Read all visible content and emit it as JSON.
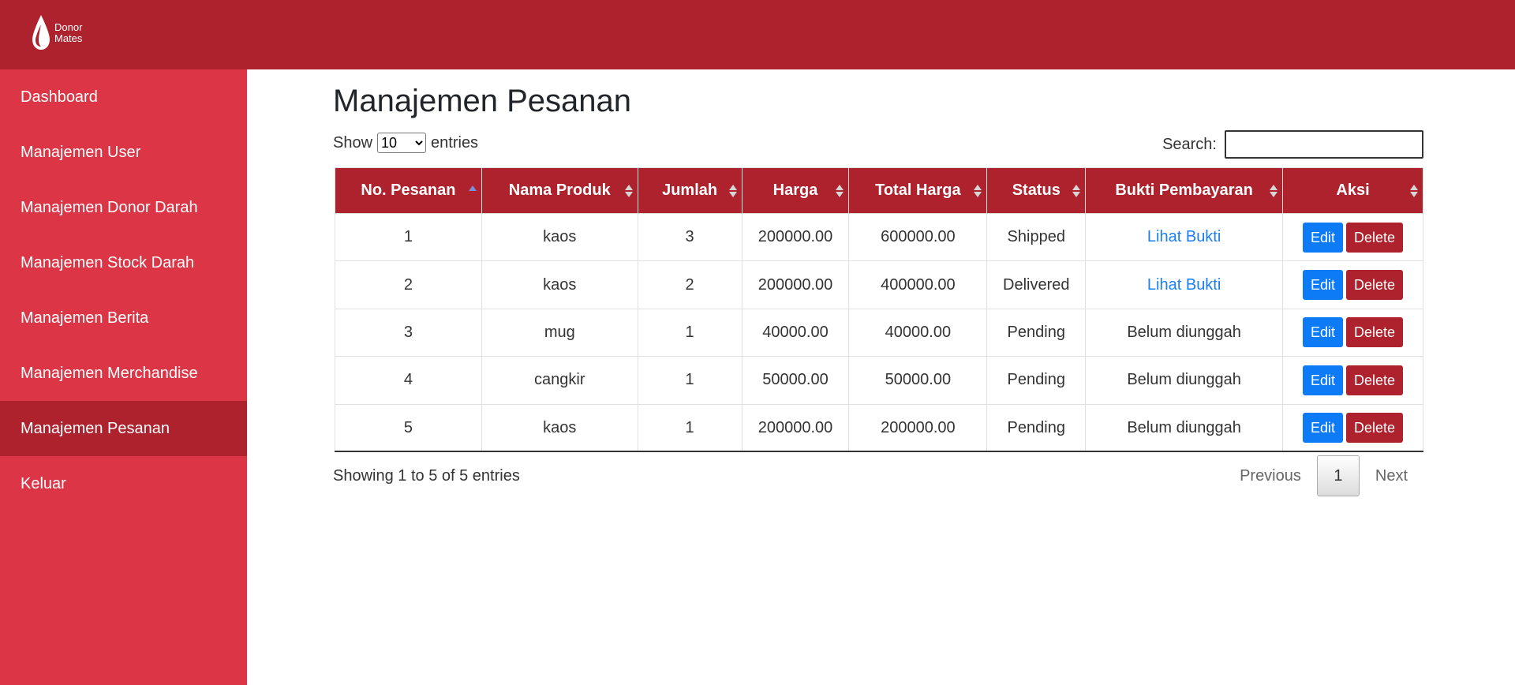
{
  "brand": {
    "line1": "Donor",
    "line2": "Mates"
  },
  "colors": {
    "header": "#ad222d",
    "sidebar": "#dc3545",
    "edit_button": "#0d7bf5",
    "delete_button": "#ad222d",
    "link": "#1a7ff5"
  },
  "sidebar": {
    "items": [
      {
        "label": "Dashboard",
        "active": false
      },
      {
        "label": "Manajemen User",
        "active": false
      },
      {
        "label": "Manajemen Donor Darah",
        "active": false
      },
      {
        "label": "Manajemen Stock Darah",
        "active": false
      },
      {
        "label": "Manajemen Berita",
        "active": false
      },
      {
        "label": "Manajemen Merchandise",
        "active": false
      },
      {
        "label": "Manajemen Pesanan",
        "active": true
      },
      {
        "label": "Keluar",
        "active": false
      }
    ]
  },
  "page": {
    "title": "Manajemen Pesanan"
  },
  "length": {
    "prefix": "Show",
    "value": "10",
    "suffix": "entries"
  },
  "search": {
    "label": "Search:",
    "value": ""
  },
  "table": {
    "columns": [
      "No. Pesanan",
      "Nama Produk",
      "Jumlah",
      "Harga",
      "Total Harga",
      "Status",
      "Bukti Pembayaran",
      "Aksi"
    ],
    "sorted_column": "No. Pesanan",
    "rows": [
      {
        "no": "1",
        "produk": "kaos",
        "jumlah": "3",
        "harga": "200000.00",
        "total": "600000.00",
        "status": "Shipped",
        "bukti": "Lihat Bukti",
        "bukti_link": true
      },
      {
        "no": "2",
        "produk": "kaos",
        "jumlah": "2",
        "harga": "200000.00",
        "total": "400000.00",
        "status": "Delivered",
        "bukti": "Lihat Bukti",
        "bukti_link": true
      },
      {
        "no": "3",
        "produk": "mug",
        "jumlah": "1",
        "harga": "40000.00",
        "total": "40000.00",
        "status": "Pending",
        "bukti": "Belum diunggah",
        "bukti_link": false
      },
      {
        "no": "4",
        "produk": "cangkir",
        "jumlah": "1",
        "harga": "50000.00",
        "total": "50000.00",
        "status": "Pending",
        "bukti": "Belum diunggah",
        "bukti_link": false
      },
      {
        "no": "5",
        "produk": "kaos",
        "jumlah": "1",
        "harga": "200000.00",
        "total": "200000.00",
        "status": "Pending",
        "bukti": "Belum diunggah",
        "bukti_link": false
      }
    ],
    "actions": {
      "edit": "Edit",
      "delete": "Delete"
    }
  },
  "info": "Showing 1 to 5 of 5 entries",
  "pagination": {
    "previous": "Previous",
    "current": "1",
    "next": "Next"
  }
}
